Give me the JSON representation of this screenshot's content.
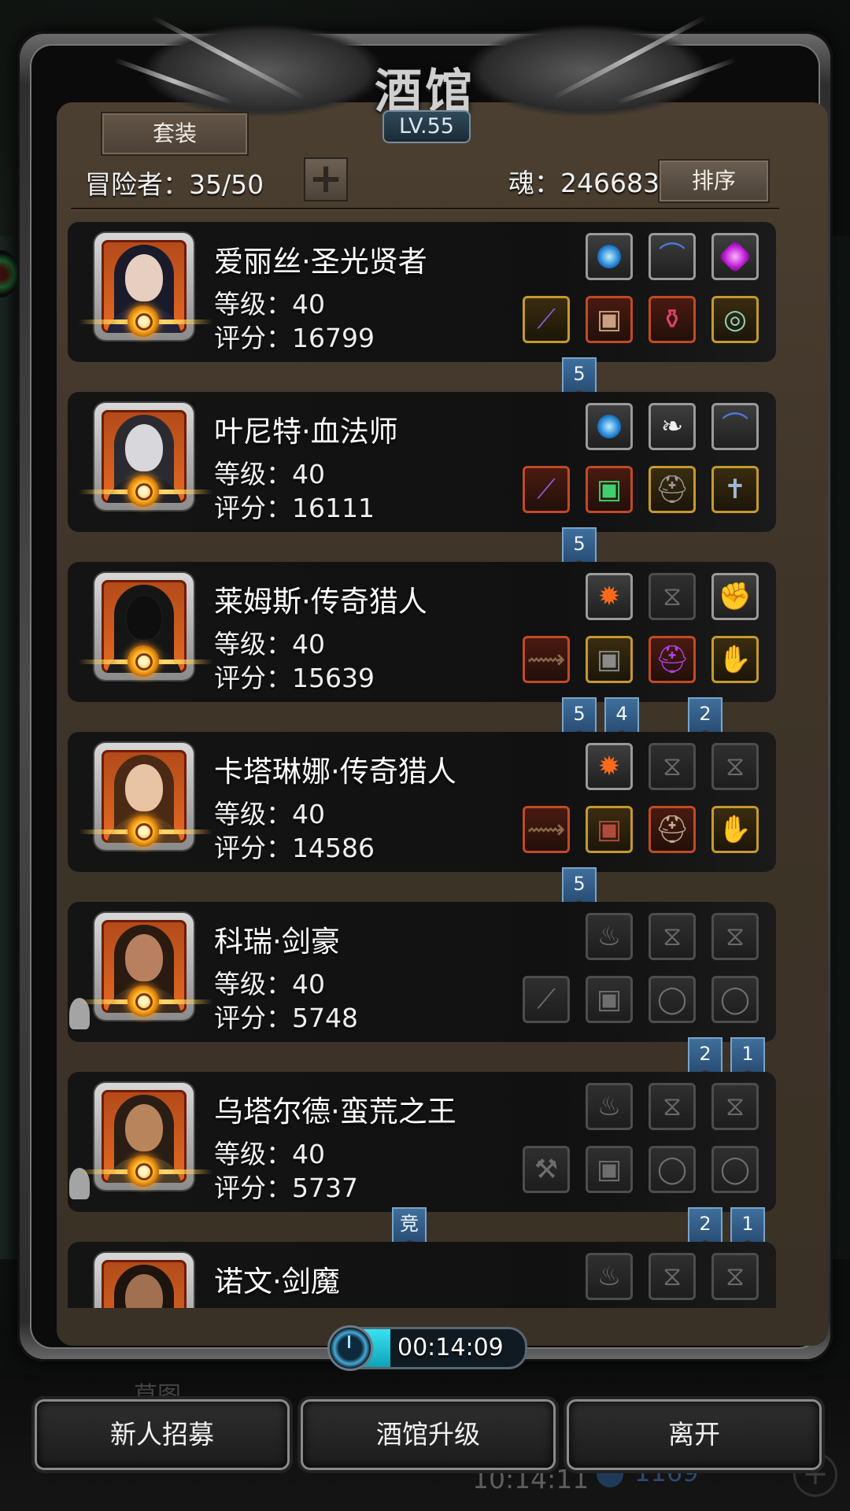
{
  "header": {
    "title": "酒馆",
    "level": "LV.55",
    "set_button": "套装",
    "adventurers": "冒险者：35/50",
    "plus_button": "+",
    "soul": "魂：246683",
    "sort_button": "排序"
  },
  "heroes": [
    {
      "name": "爱丽丝·圣光贤者",
      "level": "等级：40",
      "score": "评分：16799",
      "slots_top": [
        "blue-orb-icon",
        "bow-icon",
        "purple-gem-icon"
      ],
      "slots_bottom": [
        "staff-icon",
        "armor-icon",
        "potion-icon",
        "ring-icon"
      ],
      "tags": [
        "5"
      ]
    },
    {
      "name": "叶尼特·血法师",
      "level": "等级：40",
      "score": "评分：16111",
      "slots_top": [
        "blue-orb-icon",
        "wing-icon",
        "bow-icon"
      ],
      "slots_bottom": [
        "staff-icon",
        "armor-icon",
        "helmet-icon",
        "amulet-icon"
      ],
      "tags": [
        "5"
      ]
    },
    {
      "name": "莱姆斯·传奇猎人",
      "level": "等级：40",
      "score": "评分：15639",
      "slots_top": [
        "fire-icon",
        "empty-slot-icon",
        "gauntlet-icon"
      ],
      "slots_bottom": [
        "crossbow-icon",
        "armor-icon",
        "helmet-icon",
        "glove-icon"
      ],
      "tags": [
        "5",
        "4",
        "2"
      ]
    },
    {
      "name": "卡塔琳娜·传奇猎人",
      "level": "等级：40",
      "score": "评分：14586",
      "slots_top": [
        "fire-icon",
        "empty-slot-icon",
        "empty-slot-icon"
      ],
      "slots_bottom": [
        "crossbow-icon",
        "armor-icon",
        "helmet-icon",
        "bracer-icon"
      ],
      "tags": [
        "5"
      ]
    },
    {
      "name": "科瑞·剑豪",
      "level": "等级：40",
      "score": "评分：5748",
      "slots_top": [
        "flame-outline-icon",
        "empty-slot-icon",
        "empty-slot-icon"
      ],
      "slots_bottom": [
        "sword-outline-icon",
        "armor-outline-icon",
        "ring-outline-icon",
        "ring-outline-icon"
      ],
      "tags": [
        "2",
        "1"
      ]
    },
    {
      "name": "乌塔尔德·蛮荒之王",
      "level": "等级：40",
      "score": "评分：5737",
      "slots_top": [
        "flame-outline-icon",
        "empty-slot-icon",
        "empty-slot-icon"
      ],
      "slots_bottom": [
        "axe-outline-icon",
        "armor-outline-icon",
        "ring-outline-icon",
        "ring-outline-icon"
      ],
      "tags": [
        "竞",
        "2",
        "1"
      ]
    },
    {
      "name": "诺文·剑魔",
      "level": "",
      "score": "",
      "slots_top": [
        "flame-outline-icon",
        "empty-slot-icon",
        "empty-slot-icon"
      ],
      "slots_bottom": [],
      "tags": []
    }
  ],
  "timer": {
    "value": "00:14:09",
    "progress": 0.3
  },
  "buttons": {
    "recruit": "新人招募",
    "upgrade": "酒馆升级",
    "leave": "离开"
  },
  "background": {
    "title": "草图",
    "time": "10:14:11",
    "count": "1169",
    "plus": "+"
  }
}
